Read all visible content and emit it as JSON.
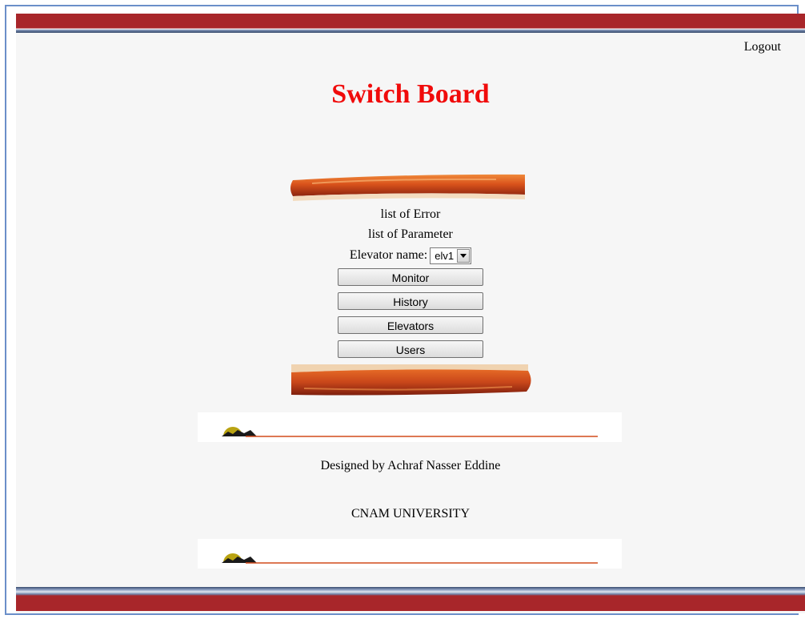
{
  "header": {
    "logout_label": "Logout"
  },
  "page_title": "Switch Board",
  "menu": {
    "error_link": "list of Error",
    "parameter_link": "list of Parameter",
    "elevator_label": "Elevator name:",
    "elevator_selected": "elv1",
    "buttons": {
      "monitor": "Monitor",
      "history": "History",
      "elevators": "Elevators",
      "users": "Users"
    }
  },
  "footer": {
    "designer": "Designed by Achraf Nasser Eddine",
    "university": "CNAM UNIVERSITY"
  },
  "colors": {
    "title": "#f00b0b",
    "banner_red": "#a8262a",
    "scroll_orange": "#d9521b"
  },
  "icons": {
    "dropdown": "chevron-down-icon",
    "divider_ornament": "sun-over-hills-icon"
  }
}
